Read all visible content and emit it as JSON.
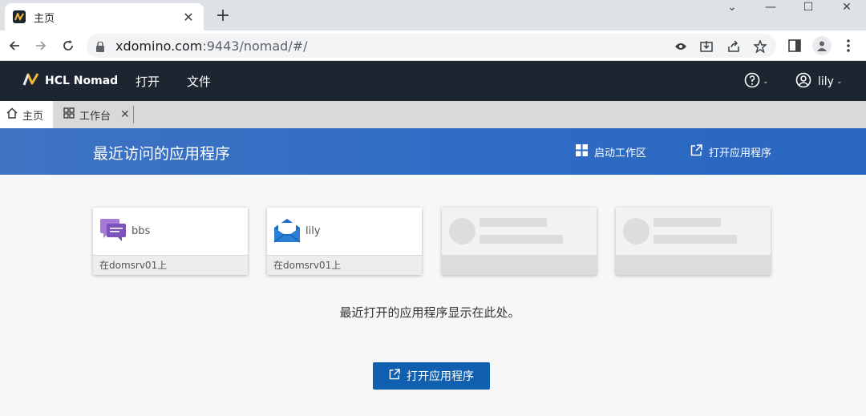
{
  "browser": {
    "tab_title": "主页",
    "url_host": "xdomino.com",
    "url_rest": ":9443/nomad/#/"
  },
  "app": {
    "brand": "HCL Nomad",
    "menu": [
      "打开",
      "文件"
    ],
    "user": "lily"
  },
  "app_tabs": [
    {
      "label": "主页"
    },
    {
      "label": "工作台"
    }
  ],
  "banner": {
    "title": "最近访问的应用程序",
    "launch_workspace": "启动工作区",
    "open_app": "打开应用程序"
  },
  "cards": [
    {
      "name": "bbs",
      "server": "在domsrv01上",
      "icon": "discussion-icon"
    },
    {
      "name": "lily",
      "server": "在domsrv01上",
      "icon": "mail-icon"
    }
  ],
  "empty_message": "最近打开的应用程序显示在此处。",
  "primary_button": "打开应用程序",
  "colors": {
    "appbar": "#1c2530",
    "banner": "#2f6cc4",
    "primary": "#1160b0",
    "brand_accent": "#f2b632"
  }
}
